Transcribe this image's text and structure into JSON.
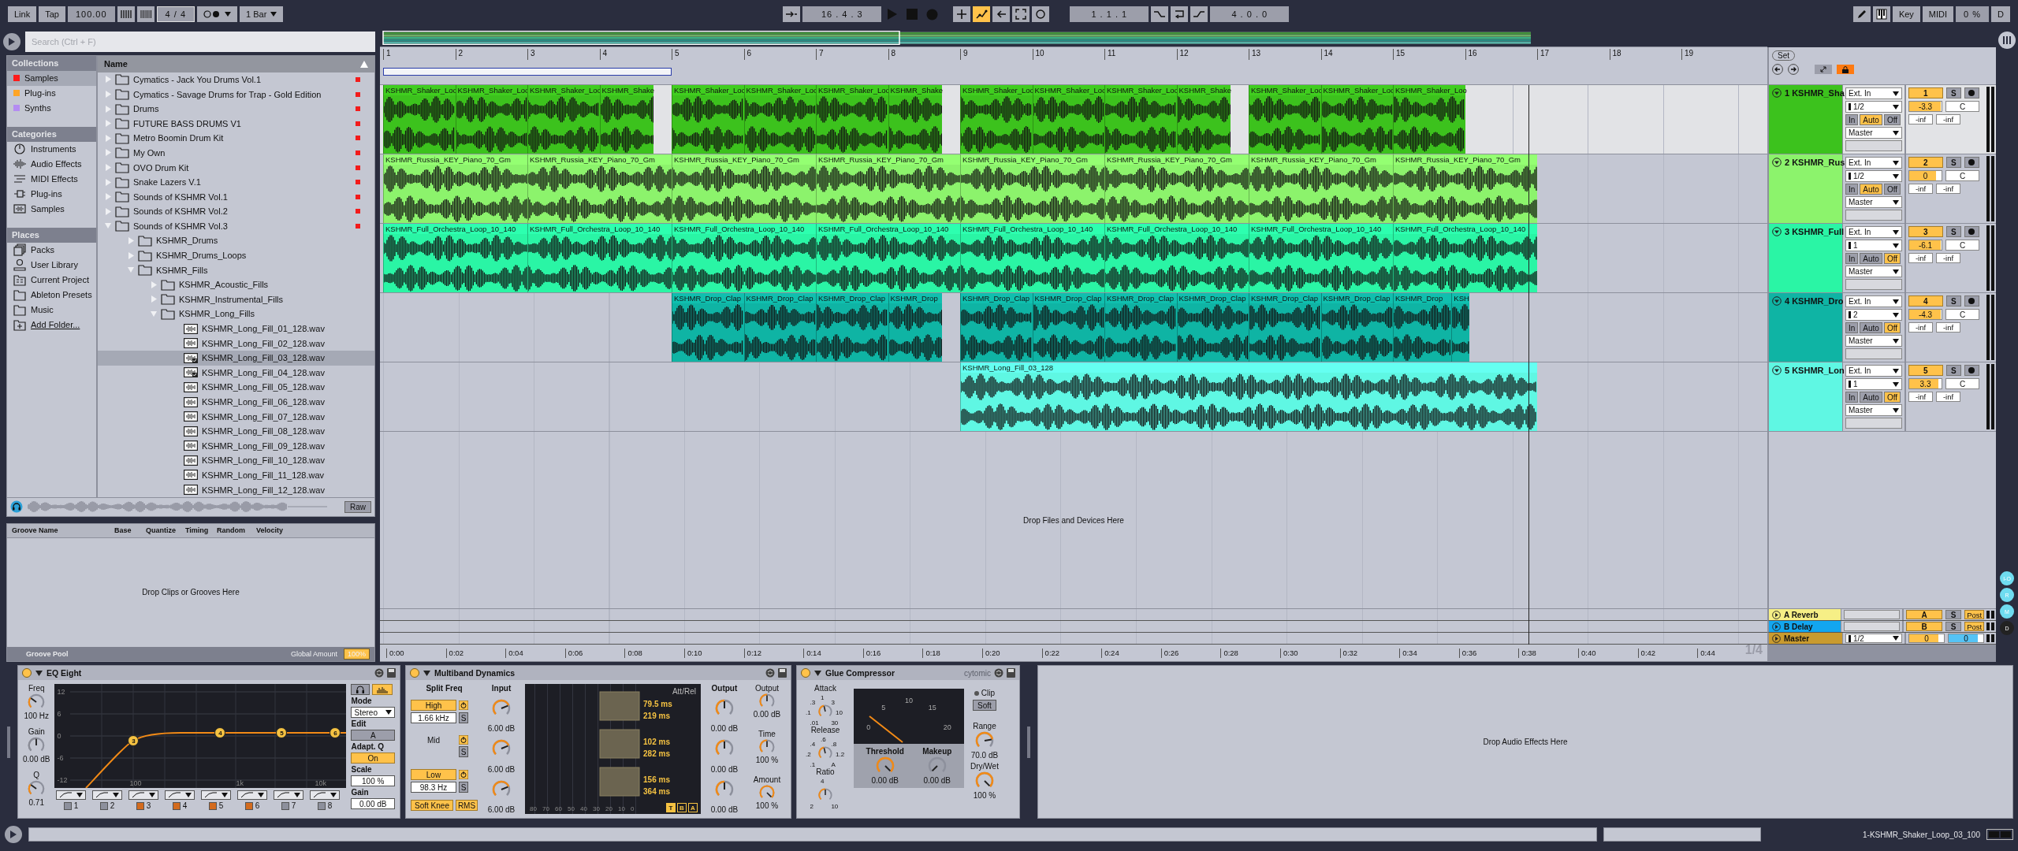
{
  "transport": {
    "link": "Link",
    "tap": "Tap",
    "tempo": "100.00",
    "signature": "4 / 4",
    "quantization": "1 Bar",
    "arrangement_position": "16 . 4 . 3",
    "loop_start": "1 . 1 . 1",
    "loop_length": "4 . 0 . 0",
    "toggles": [
      {
        "kind": "overdub",
        "on": false
      },
      {
        "kind": "automation-arm",
        "on": true
      },
      {
        "kind": "back-to-arrangement",
        "on": false
      },
      {
        "kind": "capture",
        "on": false
      },
      {
        "kind": "session-record",
        "on": false
      }
    ],
    "punch": [
      {
        "kind": "punch-in",
        "on": false
      },
      {
        "kind": "loop",
        "on": false
      },
      {
        "kind": "punch-out",
        "on": false
      }
    ],
    "key": "Key",
    "midi": "MIDI",
    "cpu": "0 %",
    "hd": "D"
  },
  "browser": {
    "search": {
      "placeholder": "Search (Ctrl + F)"
    },
    "collections_title": "Collections",
    "collections": [
      {
        "label": "Samples",
        "color": "#ff1a1a",
        "selected": true
      },
      {
        "label": "Plug-ins",
        "color": "#ffa526",
        "selected": false
      },
      {
        "label": "Synths",
        "color": "#b48cf2",
        "selected": false
      }
    ],
    "categories_title": "Categories",
    "categories": [
      {
        "label": "Instruments",
        "kind": "instrument"
      },
      {
        "label": "Audio Effects",
        "kind": "audio-effect"
      },
      {
        "label": "MIDI Effects",
        "kind": "midi-effect"
      },
      {
        "label": "Plug-ins",
        "kind": "plugin"
      },
      {
        "label": "Samples",
        "kind": "sample"
      }
    ],
    "places_title": "Places",
    "places": [
      {
        "label": "Packs",
        "kind": "packs"
      },
      {
        "label": "User Library",
        "kind": "user"
      },
      {
        "label": "Current Project",
        "kind": "project"
      },
      {
        "label": "Ableton Presets",
        "kind": "folder"
      },
      {
        "label": "Music",
        "kind": "folder"
      },
      {
        "label": "Add Folder...",
        "kind": "add"
      }
    ],
    "name_column": "Name",
    "items": [
      {
        "label": "Cymatics - Jack You Drums Vol.1",
        "kind": "folder",
        "expanded": false,
        "tagged": true,
        "selected": false
      },
      {
        "label": "Cymatics - Savage Drums for Trap - Gold Edition",
        "kind": "folder",
        "expanded": false,
        "tagged": true,
        "selected": false
      },
      {
        "label": "Drums",
        "kind": "folder",
        "expanded": false,
        "tagged": true,
        "selected": false
      },
      {
        "label": "FUTURE BASS DRUMS V1",
        "kind": "folder",
        "expanded": false,
        "tagged": true,
        "selected": false
      },
      {
        "label": "Metro Boomin Drum Kit",
        "kind": "folder",
        "expanded": false,
        "tagged": true,
        "selected": false
      },
      {
        "label": "My Own",
        "kind": "folder",
        "expanded": false,
        "tagged": true,
        "selected": false
      },
      {
        "label": "OVO Drum Kit",
        "kind": "folder",
        "expanded": false,
        "tagged": true,
        "selected": false
      },
      {
        "label": "Snake Lazers V.1",
        "kind": "folder",
        "expanded": false,
        "tagged": true,
        "selected": false
      },
      {
        "label": "Sounds of KSHMR Vol.1",
        "kind": "folder",
        "expanded": false,
        "tagged": true,
        "selected": false
      },
      {
        "label": "Sounds of KSHMR Vol.2",
        "kind": "folder",
        "expanded": false,
        "tagged": true,
        "selected": false
      },
      {
        "label": "Sounds of KSHMR Vol.3",
        "kind": "folder",
        "expanded": true,
        "tagged": true,
        "selected": false,
        "children": [
          {
            "label": "KSHMR_Drums",
            "kind": "folder",
            "expanded": false,
            "tagged": false,
            "selected": false
          },
          {
            "label": "KSHMR_Drums_Loops",
            "kind": "folder",
            "expanded": false,
            "tagged": false,
            "selected": false
          },
          {
            "label": "KSHMR_Fills",
            "kind": "folder",
            "expanded": true,
            "tagged": false,
            "selected": false,
            "children": [
              {
                "label": "KSHMR_Acoustic_Fills",
                "kind": "folder",
                "expanded": false,
                "tagged": false,
                "selected": false
              },
              {
                "label": "KSHMR_Instrumental_Fills",
                "kind": "folder",
                "expanded": false,
                "tagged": false,
                "selected": false
              },
              {
                "label": "KSHMR_Long_Fills",
                "kind": "folder",
                "expanded": true,
                "tagged": false,
                "selected": false,
                "children": [
                  {
                    "label": "KSHMR_Long_Fill_01_128.wav",
                    "kind": "sample",
                    "tagged": false,
                    "selected": false
                  },
                  {
                    "label": "KSHMR_Long_Fill_02_128.wav",
                    "kind": "sample",
                    "tagged": false,
                    "selected": false
                  },
                  {
                    "label": "KSHMR_Long_Fill_03_128.wav",
                    "kind": "sample-analyzed",
                    "tagged": false,
                    "selected": true
                  },
                  {
                    "label": "KSHMR_Long_Fill_04_128.wav",
                    "kind": "sample-analyzed",
                    "tagged": false,
                    "selected": false
                  },
                  {
                    "label": "KSHMR_Long_Fill_05_128.wav",
                    "kind": "sample",
                    "tagged": false,
                    "selected": false
                  },
                  {
                    "label": "KSHMR_Long_Fill_06_128.wav",
                    "kind": "sample",
                    "tagged": false,
                    "selected": false
                  },
                  {
                    "label": "KSHMR_Long_Fill_07_128.wav",
                    "kind": "sample",
                    "tagged": false,
                    "selected": false
                  },
                  {
                    "label": "KSHMR_Long_Fill_08_128.wav",
                    "kind": "sample",
                    "tagged": false,
                    "selected": false
                  },
                  {
                    "label": "KSHMR_Long_Fill_09_128.wav",
                    "kind": "sample",
                    "tagged": false,
                    "selected": false
                  },
                  {
                    "label": "KSHMR_Long_Fill_10_128.wav",
                    "kind": "sample",
                    "tagged": false,
                    "selected": false
                  },
                  {
                    "label": "KSHMR_Long_Fill_11_128.wav",
                    "kind": "sample",
                    "tagged": false,
                    "selected": false
                  },
                  {
                    "label": "KSHMR_Long_Fill_12_128.wav",
                    "kind": "sample",
                    "tagged": false,
                    "selected": false
                  }
                ]
              }
            ]
          }
        ]
      }
    ],
    "preview": {
      "raw": "Raw"
    }
  },
  "groove_pool": {
    "columns": [
      "Groove Name",
      "Base",
      "Quantize",
      "Timing",
      "Random",
      "Velocity"
    ],
    "placeholder": "Drop Clips or Grooves Here",
    "title": "Groove Pool",
    "global_amount_label": "Global Amount",
    "global_amount": "100%"
  },
  "arrangement": {
    "bars": [
      "1",
      "2",
      "3",
      "4",
      "5",
      "6",
      "7",
      "8",
      "9",
      "10",
      "11",
      "12",
      "13",
      "14",
      "15",
      "16",
      "17",
      "18",
      "19"
    ],
    "set_button": "Set",
    "tracks": [
      {
        "name": "1 KSHMR_Sha",
        "number": "1",
        "color": "#3cc21d",
        "selected": true,
        "input": "Ext. In",
        "channel": "1/2",
        "monitor": [
          {
            "label": "In",
            "selected": false
          },
          {
            "label": "Auto",
            "selected": true
          },
          {
            "label": "Off",
            "selected": false
          }
        ],
        "output": "Master",
        "volume": "-3.3",
        "level": 0.97,
        "pan": "C",
        "solo": "S",
        "peaks": [
          "-inf",
          "-inf"
        ],
        "clips": [
          {
            "name": "KSHMR_Shaker_Loo"
          },
          {
            "name": "KSHMR_Shaker_Loo"
          },
          {
            "name": "KSHMR_Shaker_Loo"
          },
          {
            "name": "KSHMR_Shake"
          },
          {
            "name": "KSHMR_Shaker_Loo"
          },
          {
            "name": "KSHMR_Shaker_Loo"
          },
          {
            "name": "KSHMR_Shaker_Loo"
          },
          {
            "name": "KSHMR_Shake"
          },
          {
            "name": "KSHMR_Shaker_Loo"
          },
          {
            "name": "KSHMR_Shaker_Loo"
          },
          {
            "name": "KSHMR_Shaker_Loo"
          },
          {
            "name": "KSHMR_Shake"
          },
          {
            "name": "KSHMR_Shaker_Loo"
          },
          {
            "name": "KSHMR_Shaker_Loo"
          },
          {
            "name": "KSHMR_Shaker_Loo"
          }
        ]
      },
      {
        "name": "2 KSHMR_Rus",
        "number": "2",
        "color": "#8cf36c",
        "selected": false,
        "input": "Ext. In",
        "channel": "1/2",
        "monitor": [
          {
            "label": "In",
            "selected": false
          },
          {
            "label": "Auto",
            "selected": true
          },
          {
            "label": "Off",
            "selected": false
          }
        ],
        "output": "Master",
        "volume": "0",
        "level": 0.82,
        "pan": "C",
        "solo": "S",
        "peaks": [
          "-inf",
          "-inf"
        ],
        "clips": [
          {
            "name": "KSHMR_Russia_KEY_Piano_70_Gm"
          },
          {
            "name": "KSHMR_Russia_KEY_Piano_70_Gm"
          },
          {
            "name": "KSHMR_Russia_KEY_Piano_70_Gm"
          },
          {
            "name": "KSHMR_Russia_KEY_Piano_70_Gm"
          },
          {
            "name": "KSHMR_Russia_KEY_Piano_70_Gm"
          },
          {
            "name": "KSHMR_Russia_KEY_Piano_70_Gm"
          },
          {
            "name": "KSHMR_Russia_KEY_Piano_70_Gm"
          },
          {
            "name": "KSHMR_Russia_KEY_Piano_70_Gm"
          }
        ]
      },
      {
        "name": "3 KSHMR_Full",
        "number": "3",
        "color": "#2af5a5",
        "selected": false,
        "input": "Ext. In",
        "channel": "1",
        "monitor": [
          {
            "label": "In",
            "selected": false
          },
          {
            "label": "Auto",
            "selected": false
          },
          {
            "label": "Off",
            "selected": true
          }
        ],
        "output": "Master",
        "volume": "-6.1",
        "level": 0.97,
        "pan": "C",
        "solo": "S",
        "peaks": [
          "-inf",
          "-inf"
        ],
        "clips": [
          {
            "name": "KSHMR_Full_Orchestra_Loop_10_140"
          },
          {
            "name": "KSHMR_Full_Orchestra_Loop_10_140"
          },
          {
            "name": "KSHMR_Full_Orchestra_Loop_10_140"
          },
          {
            "name": "KSHMR_Full_Orchestra_Loop_10_140"
          },
          {
            "name": "KSHMR_Full_Orchestra_Loop_10_140"
          },
          {
            "name": "KSHMR_Full_Orchestra_Loop_10_140"
          },
          {
            "name": "KSHMR_Full_Orchestra_Loop_10_140"
          },
          {
            "name": "KSHMR_Full_Orchestra_Loop_10_140"
          }
        ]
      },
      {
        "name": "4 KSHMR_Dro",
        "number": "4",
        "color": "#0fb4a4",
        "selected": false,
        "input": "Ext. In",
        "channel": "2",
        "monitor": [
          {
            "label": "In",
            "selected": false
          },
          {
            "label": "Auto",
            "selected": false
          },
          {
            "label": "Off",
            "selected": true
          }
        ],
        "output": "Master",
        "volume": "-4.3",
        "level": 0.97,
        "pan": "C",
        "solo": "S",
        "peaks": [
          "-inf",
          "-inf"
        ],
        "clips": [
          {
            "name": "KSHMR_Drop_Clap"
          },
          {
            "name": "KSHMR_Drop_Clap"
          },
          {
            "name": "KSHMR_Drop_Clap"
          },
          {
            "name": "KSHMR_Drop"
          },
          {
            "name": "KSHMR_Drop_Clap"
          },
          {
            "name": "KSHMR_Drop_Clap"
          },
          {
            "name": "KSHMR_Drop_Clap"
          },
          {
            "name": "KSHMR_Drop_Clap"
          },
          {
            "name": "KSHMR_Drop_Clap"
          },
          {
            "name": "KSHMR_Drop_Clap"
          },
          {
            "name": "KSHMR_Drop"
          },
          {
            "name": "KSH"
          }
        ]
      },
      {
        "name": "5 KSHMR_Lon",
        "number": "5",
        "color": "#5ff7e3",
        "selected": false,
        "input": "Ext. In",
        "channel": "1",
        "monitor": [
          {
            "label": "In",
            "selected": false
          },
          {
            "label": "Auto",
            "selected": false
          },
          {
            "label": "Off",
            "selected": true
          }
        ],
        "output": "Master",
        "volume": "3.3",
        "level": 0.9,
        "pan": "C",
        "solo": "S",
        "peaks": [
          "-inf",
          "-inf"
        ],
        "clips": [
          {
            "name": "KSHMR_Long_Fill_03_128"
          }
        ]
      }
    ],
    "drop_hint": "Drop Files and Devices Here",
    "returns": [
      {
        "kind": "return",
        "name": "A Reverb",
        "color": "#f6ef86",
        "send": "A",
        "solo": "S",
        "post": "Post"
      },
      {
        "kind": "return",
        "name": "B Delay",
        "color": "#12a6f0",
        "send": "B",
        "solo": "S",
        "post": "Post"
      },
      {
        "kind": "master",
        "name": "Master",
        "color": "#c99b2f",
        "channel": "1/2",
        "volume": "0",
        "level": 0.85,
        "cue": {
          "value": "0",
          "level": 0.85
        }
      }
    ],
    "times": [
      "0:00",
      "0:02",
      "0:04",
      "0:06",
      "0:08",
      "0:10",
      "0:12",
      "0:14",
      "0:16",
      "0:18",
      "0:20",
      "0:22",
      "0:24",
      "0:26",
      "0:28",
      "0:30",
      "0:32",
      "0:34",
      "0:36",
      "0:38",
      "0:40",
      "0:42",
      "0:44"
    ],
    "zoom": "1/4"
  },
  "side_buttons": [
    {
      "label": "I-O",
      "on": true
    },
    {
      "label": "R",
      "on": true
    },
    {
      "label": "M",
      "on": true
    },
    {
      "label": "D",
      "on": false
    }
  ],
  "devices": [
    {
      "kind": "eq8",
      "name": "EQ Eight",
      "on": true,
      "knobs": [
        {
          "label": "Freq",
          "value": "100 Hz",
          "disabled": false
        },
        {
          "label": "Gain",
          "value": "0.00 dB",
          "disabled": true
        },
        {
          "label": "Q",
          "value": "0.71",
          "disabled": false
        }
      ],
      "y_labels": [
        "12",
        "6",
        "0",
        "-6",
        "-12"
      ],
      "x_labels": [
        "100",
        "1k",
        "10k"
      ],
      "points": [
        "3",
        "4",
        "5",
        "6"
      ],
      "bands": [
        {
          "number": "1",
          "on": false
        },
        {
          "number": "2",
          "on": false
        },
        {
          "number": "3",
          "on": true
        },
        {
          "number": "4",
          "on": true
        },
        {
          "number": "5",
          "on": true
        },
        {
          "number": "6",
          "on": true
        },
        {
          "number": "7",
          "on": false
        },
        {
          "number": "8",
          "on": false
        }
      ],
      "mode_label": "Mode",
      "mode": "Stereo",
      "edit_label": "Edit",
      "edit": "A",
      "adapt_label": "Adapt. Q",
      "adapt": "On",
      "scale_label": "Scale",
      "scale": "100 %",
      "gain_label": "Gain",
      "gain": "0.00 dB"
    },
    {
      "kind": "multiband",
      "name": "Multiband Dynamics",
      "on": true,
      "split_label": "Split Freq",
      "bands": [
        {
          "kind": "button",
          "label": "High",
          "freq": "1.66 kHz",
          "solo": "S"
        },
        {
          "kind": "label",
          "label": "Mid",
          "solo": "S"
        },
        {
          "kind": "button",
          "label": "Low",
          "freq": "98.3 Hz",
          "solo": "S"
        }
      ],
      "input_label": "Input",
      "inputs": [
        {
          "value": "6.00 dB"
        },
        {
          "value": "6.00 dB"
        },
        {
          "value": "6.00 dB"
        }
      ],
      "soft_knee": "Soft Knee",
      "rms": "RMS",
      "scale": [
        "80",
        "70",
        "60",
        "50",
        "40",
        "30",
        "20",
        "10",
        "0"
      ],
      "att_rel_label": "Att/Rel",
      "att_rel": [
        [
          "79.5 ms",
          "219 ms"
        ],
        [
          "102 ms",
          "282 ms"
        ],
        [
          "156 ms",
          "364 ms"
        ]
      ],
      "mode_buttons": [
        {
          "label": "T",
          "selected": true
        },
        {
          "label": "B",
          "selected": false
        },
        {
          "label": "A",
          "selected": false
        }
      ],
      "output_label": "Output",
      "outputs": [
        {
          "value": "0.00 dB"
        },
        {
          "value": "0.00 dB"
        },
        {
          "value": "0.00 dB"
        }
      ],
      "master": [
        {
          "label": "Output",
          "value": "0.00 dB"
        },
        {
          "label": "Time",
          "value": "100 %"
        },
        {
          "label": "Amount",
          "value": "100 %"
        }
      ]
    },
    {
      "kind": "glue",
      "name": "Glue Compressor",
      "on": true,
      "brand": "cytomic",
      "knobs": [
        {
          "label": "Attack",
          "marks": [
            ".01",
            ".1",
            ".3",
            "1",
            "3",
            "10",
            "30"
          ]
        },
        {
          "label": "Release",
          "marks": [
            ".1",
            ".2",
            ".4",
            ".6",
            ".8",
            "1.2",
            "A"
          ]
        },
        {
          "label": "Ratio",
          "marks": [
            "2",
            "4",
            "10"
          ]
        }
      ],
      "meter_marks": [
        "0",
        "5",
        "10",
        "15",
        "20"
      ],
      "threshold": {
        "label": "Threshold",
        "value": "0.00 dB"
      },
      "makeup": {
        "label": "Makeup",
        "value": "0.00 dB"
      },
      "clip_label": "Clip",
      "clip": "Soft",
      "range": {
        "label": "Range",
        "value": "70.0 dB"
      },
      "drywet": {
        "label": "Dry/Wet",
        "value": "100 %"
      }
    }
  ],
  "device_drop_hint": "Drop Audio Effects Here",
  "status": {
    "clip_name": "1-KSHMR_Shaker_Loop_03_100"
  }
}
